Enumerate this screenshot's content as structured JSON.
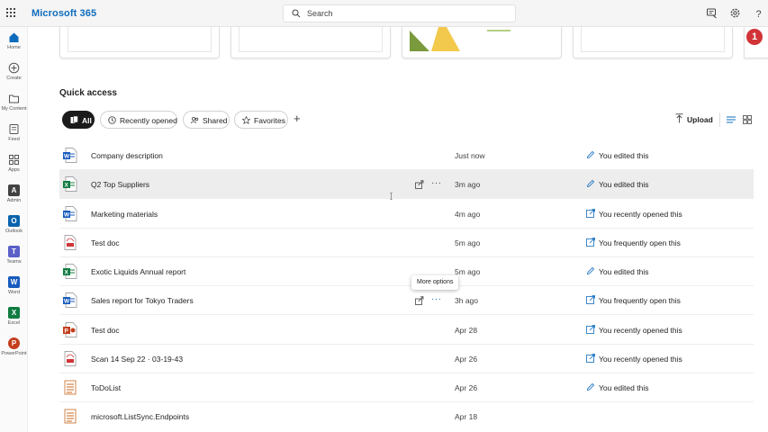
{
  "app": {
    "brand": "Microsoft 365"
  },
  "search": {
    "placeholder": "Search"
  },
  "colors": {
    "accent": "#0f6cbd",
    "word": "#185abd",
    "excel": "#107c41",
    "powerpoint": "#c43e1c",
    "outlook": "#0a64ad",
    "teams": "#5b5fc7",
    "notification": "#d13438"
  },
  "topbar_icons": [
    "waffle-icon",
    "feedback-icon",
    "settings-icon",
    "help-icon"
  ],
  "rail": [
    {
      "label": "Home",
      "icon": "home-icon"
    },
    {
      "label": "Create",
      "icon": "create-icon"
    },
    {
      "label": "My Content",
      "icon": "folder-icon"
    },
    {
      "label": "Feed",
      "icon": "feed-icon"
    },
    {
      "label": "Apps",
      "icon": "apps-icon"
    },
    {
      "label": "Admin",
      "icon": "admin-icon"
    },
    {
      "label": "Outlook",
      "icon": "outlook-icon"
    },
    {
      "label": "Teams",
      "icon": "teams-icon"
    },
    {
      "label": "Word",
      "icon": "word-icon"
    },
    {
      "label": "Excel",
      "icon": "excel-icon"
    },
    {
      "label": "PowerPoint",
      "icon": "powerpoint-icon"
    }
  ],
  "notification": {
    "count": "1"
  },
  "quick_access": {
    "title": "Quick access",
    "filters": [
      "All",
      "Recently opened",
      "Shared",
      "Favorites"
    ],
    "add": "+",
    "upload": "Upload"
  },
  "files": [
    {
      "name": "Company description",
      "date": "Just now",
      "activity": "You edited this",
      "type": "word",
      "activity_icon": "pencil"
    },
    {
      "name": "Q2 Top Suppliers",
      "date": "3m ago",
      "activity": "You edited this",
      "type": "excel",
      "activity_icon": "pencil"
    },
    {
      "name": "Marketing materials",
      "date": "4m ago",
      "activity": "You recently opened this",
      "type": "word",
      "activity_icon": "open"
    },
    {
      "name": "Test doc",
      "date": "5m ago",
      "activity": "You frequently open this",
      "type": "pdf",
      "activity_icon": "open"
    },
    {
      "name": "Exotic Liquids Annual report",
      "date": "5m ago",
      "activity": "You edited this",
      "type": "excel",
      "activity_icon": "pencil"
    },
    {
      "name": "Sales report for Tokyo Traders",
      "date": "3h ago",
      "activity": "You frequently open this",
      "type": "word",
      "activity_icon": "open"
    },
    {
      "name": "Test doc",
      "date": "Apr 28",
      "activity": "You recently opened this",
      "type": "powerpoint",
      "activity_icon": "open"
    },
    {
      "name": "Scan 14 Sep 22 · 03-19-43",
      "date": "Apr 26",
      "activity": "You recently opened this",
      "type": "pdf",
      "activity_icon": "open"
    },
    {
      "name": "ToDoList",
      "date": "Apr 26",
      "activity": "You edited this",
      "type": "list",
      "activity_icon": "pencil"
    },
    {
      "name": "microsoft.ListSync.Endpoints",
      "date": "Apr 18",
      "activity": "",
      "type": "list",
      "activity_icon": ""
    }
  ],
  "tooltip": "More options",
  "more_label": "···"
}
